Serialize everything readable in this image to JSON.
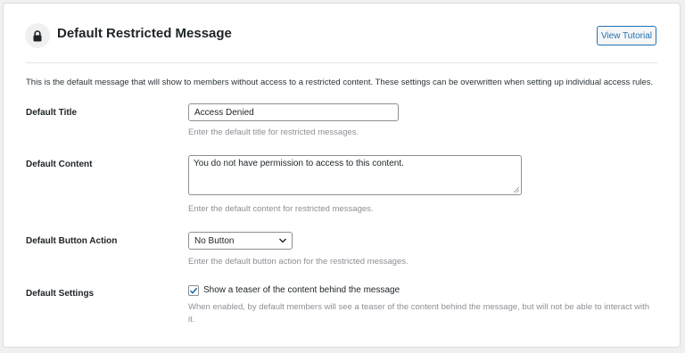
{
  "header": {
    "title": "Default Restricted Message",
    "tutorial_button": "View Tutorial",
    "icon": "lock-icon"
  },
  "intro_text": "This is the default message that will show to members without access to a restricted content. These settings can be overwritten when setting up individual access rules.",
  "fields": {
    "title": {
      "label": "Default Title",
      "value": "Access Denied",
      "description": "Enter the default title for restricted messages."
    },
    "content": {
      "label": "Default Content",
      "value": "You do not have permission to access to this content.",
      "description": "Enter the default content for restricted messages."
    },
    "button_action": {
      "label": "Default Button Action",
      "selected": "No Button",
      "description": "Enter the default button action for the restricted messages."
    },
    "settings": {
      "label": "Default Settings",
      "checkbox_label": "Show a teaser of the content behind the message",
      "checked": true,
      "description": "When enabled, by default members will see a teaser of the content behind the message, but will not be able to interact with it."
    }
  },
  "colors": {
    "accent": "#2271b1",
    "muted_text": "#8c8f94",
    "background": "#f0f0f1"
  }
}
